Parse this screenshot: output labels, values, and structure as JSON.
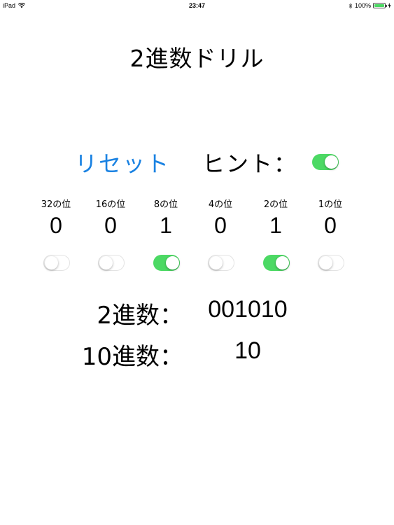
{
  "status_bar": {
    "device": "iPad",
    "time": "23:47",
    "battery_percent": "100%",
    "battery_level": 1.0
  },
  "title": "2進数ドリル",
  "controls": {
    "reset_label": "リセット",
    "hint_label": "ヒント：",
    "hint_enabled": true
  },
  "bits": [
    {
      "place_label": "32の位",
      "digit": "0",
      "enabled": false
    },
    {
      "place_label": "16の位",
      "digit": "0",
      "enabled": false
    },
    {
      "place_label": "8の位",
      "digit": "1",
      "enabled": true
    },
    {
      "place_label": "4の位",
      "digit": "0",
      "enabled": false
    },
    {
      "place_label": "2の位",
      "digit": "1",
      "enabled": true
    },
    {
      "place_label": "1の位",
      "digit": "0",
      "enabled": false
    }
  ],
  "results": {
    "binary_label": "2進数：",
    "binary_value": "001010",
    "decimal_label": "10進数：",
    "decimal_value": "10"
  },
  "colors": {
    "accent": "#1a82e2",
    "switch_on": "#4cd964",
    "switch_off_border": "#e3e3e3"
  }
}
